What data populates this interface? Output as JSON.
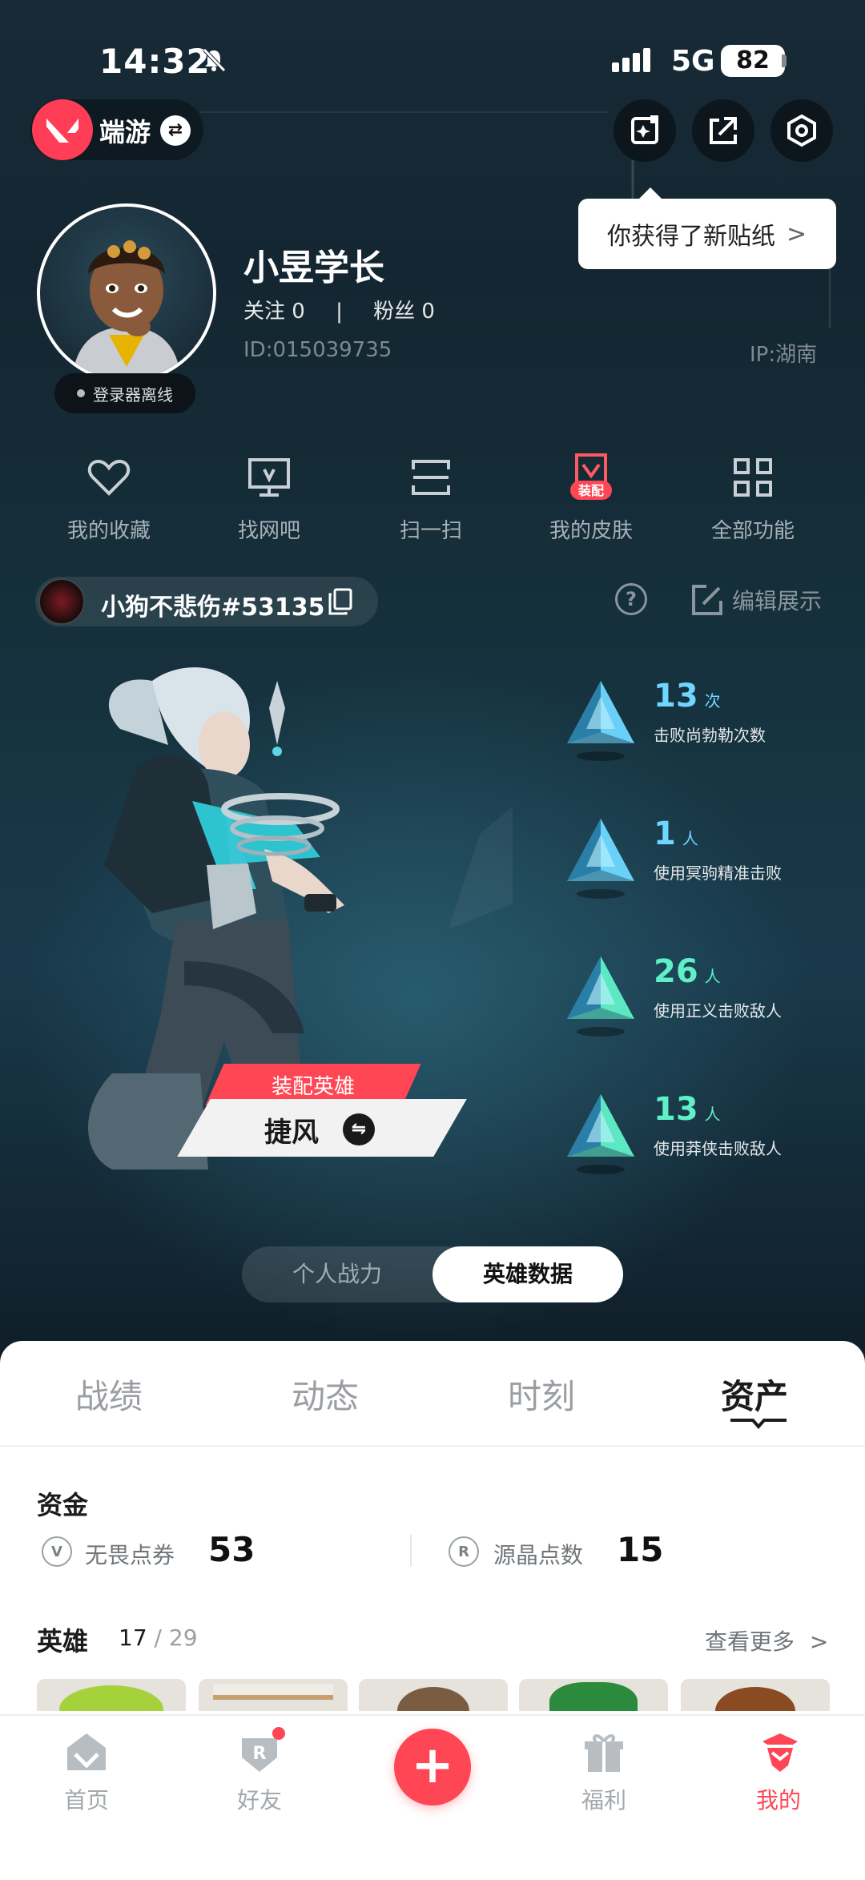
{
  "status_bar": {
    "time": "14:32",
    "network": "5G",
    "battery": "82"
  },
  "app_switch": {
    "name": "端游"
  },
  "tooltip": {
    "text": "你获得了新贴纸"
  },
  "profile": {
    "username": "小昱学长",
    "follow": "关注 0",
    "separator": "|",
    "fans": "粉丝 0",
    "id": "ID:015039735",
    "ip": "IP:湖南",
    "status": "登录器离线"
  },
  "shortcuts": [
    {
      "label": "我的收藏",
      "icon": "heart-icon"
    },
    {
      "label": "找网吧",
      "icon": "monitor-icon"
    },
    {
      "label": "扫一扫",
      "icon": "scan-icon"
    },
    {
      "label": "我的皮肤",
      "icon": "skin-icon",
      "badge": "装配"
    },
    {
      "label": "全部功能",
      "icon": "grid-icon"
    }
  ],
  "account": {
    "name": "小狗不悲伤#53135",
    "edit_label": "编辑展示",
    "help": "?"
  },
  "hero_showcase": {
    "equip_label": "装配英雄",
    "hero_name": "捷风",
    "stats": [
      {
        "value": "13",
        "unit": "次",
        "label": "击败尚勃勒次数",
        "color": "#6fd7ff"
      },
      {
        "value": "1",
        "unit": "人",
        "label": "使用冥驹精准击败",
        "color": "#6fd7ff"
      },
      {
        "value": "26",
        "unit": "人",
        "label": "使用正义击败敌人",
        "color": "#5ff0c8"
      },
      {
        "value": "13",
        "unit": "人",
        "label": "使用莽侠击败敌人",
        "color": "#5ff0c8"
      }
    ],
    "toggle": {
      "left": "个人战力",
      "right": "英雄数据"
    }
  },
  "tabs": [
    "战绩",
    "动态",
    "时刻",
    "资产"
  ],
  "active_tab": "资产",
  "funds": {
    "title": "资金",
    "items": [
      {
        "label": "无畏点券",
        "value": "53",
        "icon": "V"
      },
      {
        "label": "源晶点数",
        "value": "15",
        "icon": "R"
      }
    ]
  },
  "heroes": {
    "title": "英雄",
    "owned": "17",
    "total": " / 29",
    "more": "查看更多"
  },
  "bottom_nav": [
    {
      "label": "首页",
      "icon": "home-icon"
    },
    {
      "label": "好友",
      "icon": "friends-icon"
    },
    {
      "label": "福利",
      "icon": "gift-icon"
    },
    {
      "label": "我的",
      "icon": "profile-icon"
    }
  ],
  "colors": {
    "accent": "#ff4655",
    "panel": "#ffffff",
    "dark_bg": "#142631"
  }
}
